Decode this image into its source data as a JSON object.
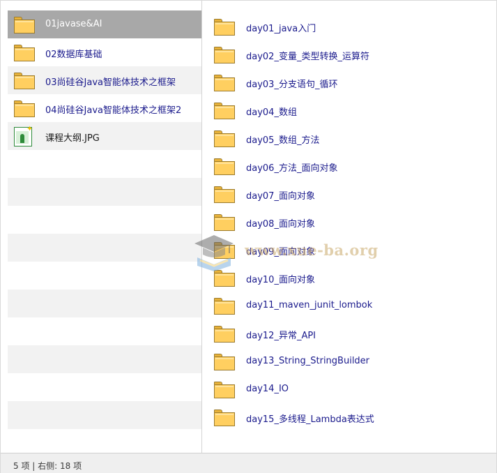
{
  "left_pane": {
    "items": [
      {
        "label": "01javase&AI",
        "icon": "folder-icon",
        "selected": true
      },
      {
        "label": "02数据库基础",
        "icon": "folder-icon"
      },
      {
        "label": "03尚硅谷Java智能体技术之框架",
        "icon": "folder-icon"
      },
      {
        "label": "04尚硅谷Java智能体技术之框架2",
        "icon": "folder-icon"
      },
      {
        "label": "课程大纲.JPG",
        "icon": "image-file-icon"
      }
    ]
  },
  "right_pane": {
    "items": [
      {
        "label": "day01_java入门",
        "icon": "folder-icon"
      },
      {
        "label": "day02_变量_类型转换_运算符",
        "icon": "folder-icon"
      },
      {
        "label": "day03_分支语句_循环",
        "icon": "folder-icon"
      },
      {
        "label": "day04_数组",
        "icon": "folder-icon"
      },
      {
        "label": "day05_数组_方法",
        "icon": "folder-icon"
      },
      {
        "label": "day06_方法_面向对象",
        "icon": "folder-icon"
      },
      {
        "label": "day07_面向对象",
        "icon": "folder-icon"
      },
      {
        "label": "day08_面向对象",
        "icon": "folder-icon"
      },
      {
        "label": "day09_面向对象",
        "icon": "folder-icon"
      },
      {
        "label": "day10_面向对象",
        "icon": "folder-icon"
      },
      {
        "label": "day11_maven_junit_lombok",
        "icon": "folder-icon"
      },
      {
        "label": "day12_异常_API",
        "icon": "folder-icon"
      },
      {
        "label": "day13_String_StringBuilder",
        "icon": "folder-icon"
      },
      {
        "label": "day14_IO",
        "icon": "folder-icon"
      },
      {
        "label": "day15_多线程_Lambda表达式",
        "icon": "folder-icon"
      }
    ]
  },
  "watermark": {
    "text": "www.xue-ba.org",
    "icon": "graduation-cap-icon"
  },
  "status_bar": {
    "text": "5 项 | 右侧: 18 项"
  },
  "colors": {
    "label_text": "#1a1a8c",
    "selected_row": "#a8a8a8",
    "stripe": "#f2f2f2",
    "folder": "#ffcf60",
    "status_bg": "#efefef"
  }
}
